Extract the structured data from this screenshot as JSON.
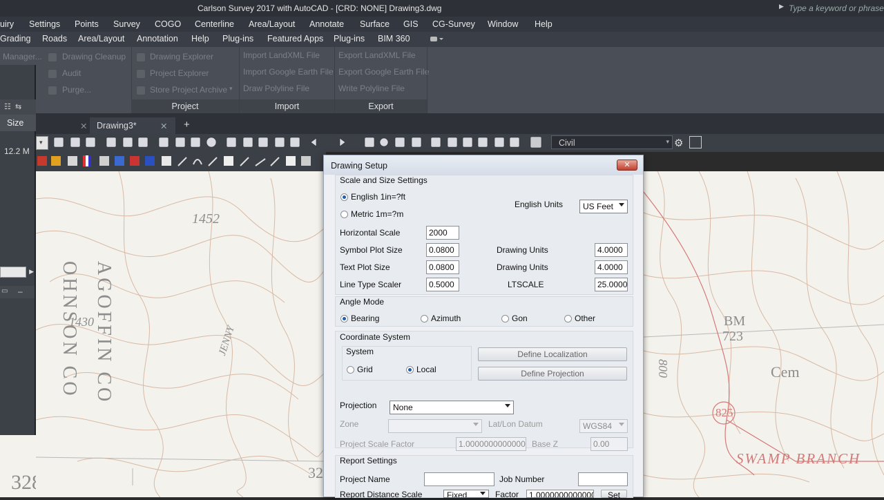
{
  "title_bar": {
    "title": "Carlson Survey 2017 with AutoCAD - [CRD: NONE]    Drawing3.dwg",
    "search_placeholder": "Type a keyword or phrase"
  },
  "menu_bar": [
    "uiry",
    "Settings",
    "Points",
    "Survey",
    "COGO",
    "Centerline",
    "Area/Layout",
    "Annotate",
    "Surface",
    "GIS",
    "CG-Survey",
    "Window",
    "Help"
  ],
  "ribbon_tabs": [
    "Grading",
    "Roads",
    "Area/Layout",
    "Annotation",
    "Help",
    "Plug-ins",
    "Featured Apps",
    "Plug-ins",
    "BIM 360"
  ],
  "ribbon": {
    "left_cmds": [
      "Manager...",
      "Drawing Cleanup",
      "Audit",
      "Purge..."
    ],
    "project_cmds": [
      "Drawing Explorer",
      "Project Explorer",
      "Store Project Archive"
    ],
    "import_cmds": [
      "Import LandXML File",
      "Import Google Earth File",
      "Draw Polyline File"
    ],
    "export_cmds": [
      "Export LandXML File",
      "Export Google Earth File",
      "Write Polyline File"
    ],
    "panels": [
      "Project",
      "Import",
      "Export"
    ]
  },
  "left_panel": {
    "size_header": "Size",
    "size_value": "12.2 M"
  },
  "file_tabs": {
    "active": "Drawing3*",
    "add": "+"
  },
  "toolbar": {
    "layer_combo": "Civil"
  },
  "map_labels": {
    "contour_1452": "1452",
    "contour_1430": "1430",
    "county_1": "OHNSON CO",
    "county_2": "AGOFFIN CO",
    "road": "JENNY",
    "bm": "BM",
    "bm_num": "723",
    "cem": "Cem",
    "elev_825": "825",
    "swamp": "SWAMP BRANCH",
    "contour_800": "800",
    "bottom_328": "328",
    "bottom_32": "32"
  },
  "dialog": {
    "title": "Drawing Setup",
    "close": "✕",
    "scale_section": "Scale and Size Settings",
    "english_radio": "English 1in=?ft",
    "metric_radio": "Metric 1m=?m",
    "english_units_label": "English Units",
    "english_units_value": "US Feet",
    "horizontal_scale_label": "Horizontal Scale",
    "horizontal_scale_value": "2000",
    "symbol_plot_label": "Symbol Plot Size",
    "symbol_plot_value": "0.0800",
    "text_plot_label": "Text Plot Size",
    "text_plot_value": "0.0800",
    "line_type_label": "Line Type Scaler",
    "line_type_value": "0.5000",
    "drawing_units_label": "Drawing Units",
    "drawing_units_1": "4.0000",
    "drawing_units_2": "4.0000",
    "ltscale_label": "LTSCALE",
    "ltscale_value": "25.0000",
    "angle_section": "Angle Mode",
    "angle_modes": [
      "Bearing",
      "Azimuth",
      "Gon",
      "Other"
    ],
    "coord_section": "Coordinate System",
    "system_label": "System",
    "grid_radio": "Grid",
    "local_radio": "Local",
    "define_localization": "Define Localization",
    "define_projection": "Define Projection",
    "projection_label": "Projection",
    "projection_value": "None",
    "zone_label": "Zone",
    "latlon_label": "Lat/Lon Datum",
    "latlon_value": "WGS84",
    "scale_factor_label": "Project Scale Factor",
    "scale_factor_value": "1.00000000000000",
    "basez_label": "Base Z",
    "basez_value": "0.00",
    "report_section": "Report Settings",
    "project_name_label": "Project Name",
    "job_number_label": "Job Number",
    "report_distance_label": "Report Distance Scale",
    "report_distance_value": "Fixed",
    "factor_label": "Factor",
    "factor_value": "1.00000000000000",
    "set_button": "Set"
  }
}
